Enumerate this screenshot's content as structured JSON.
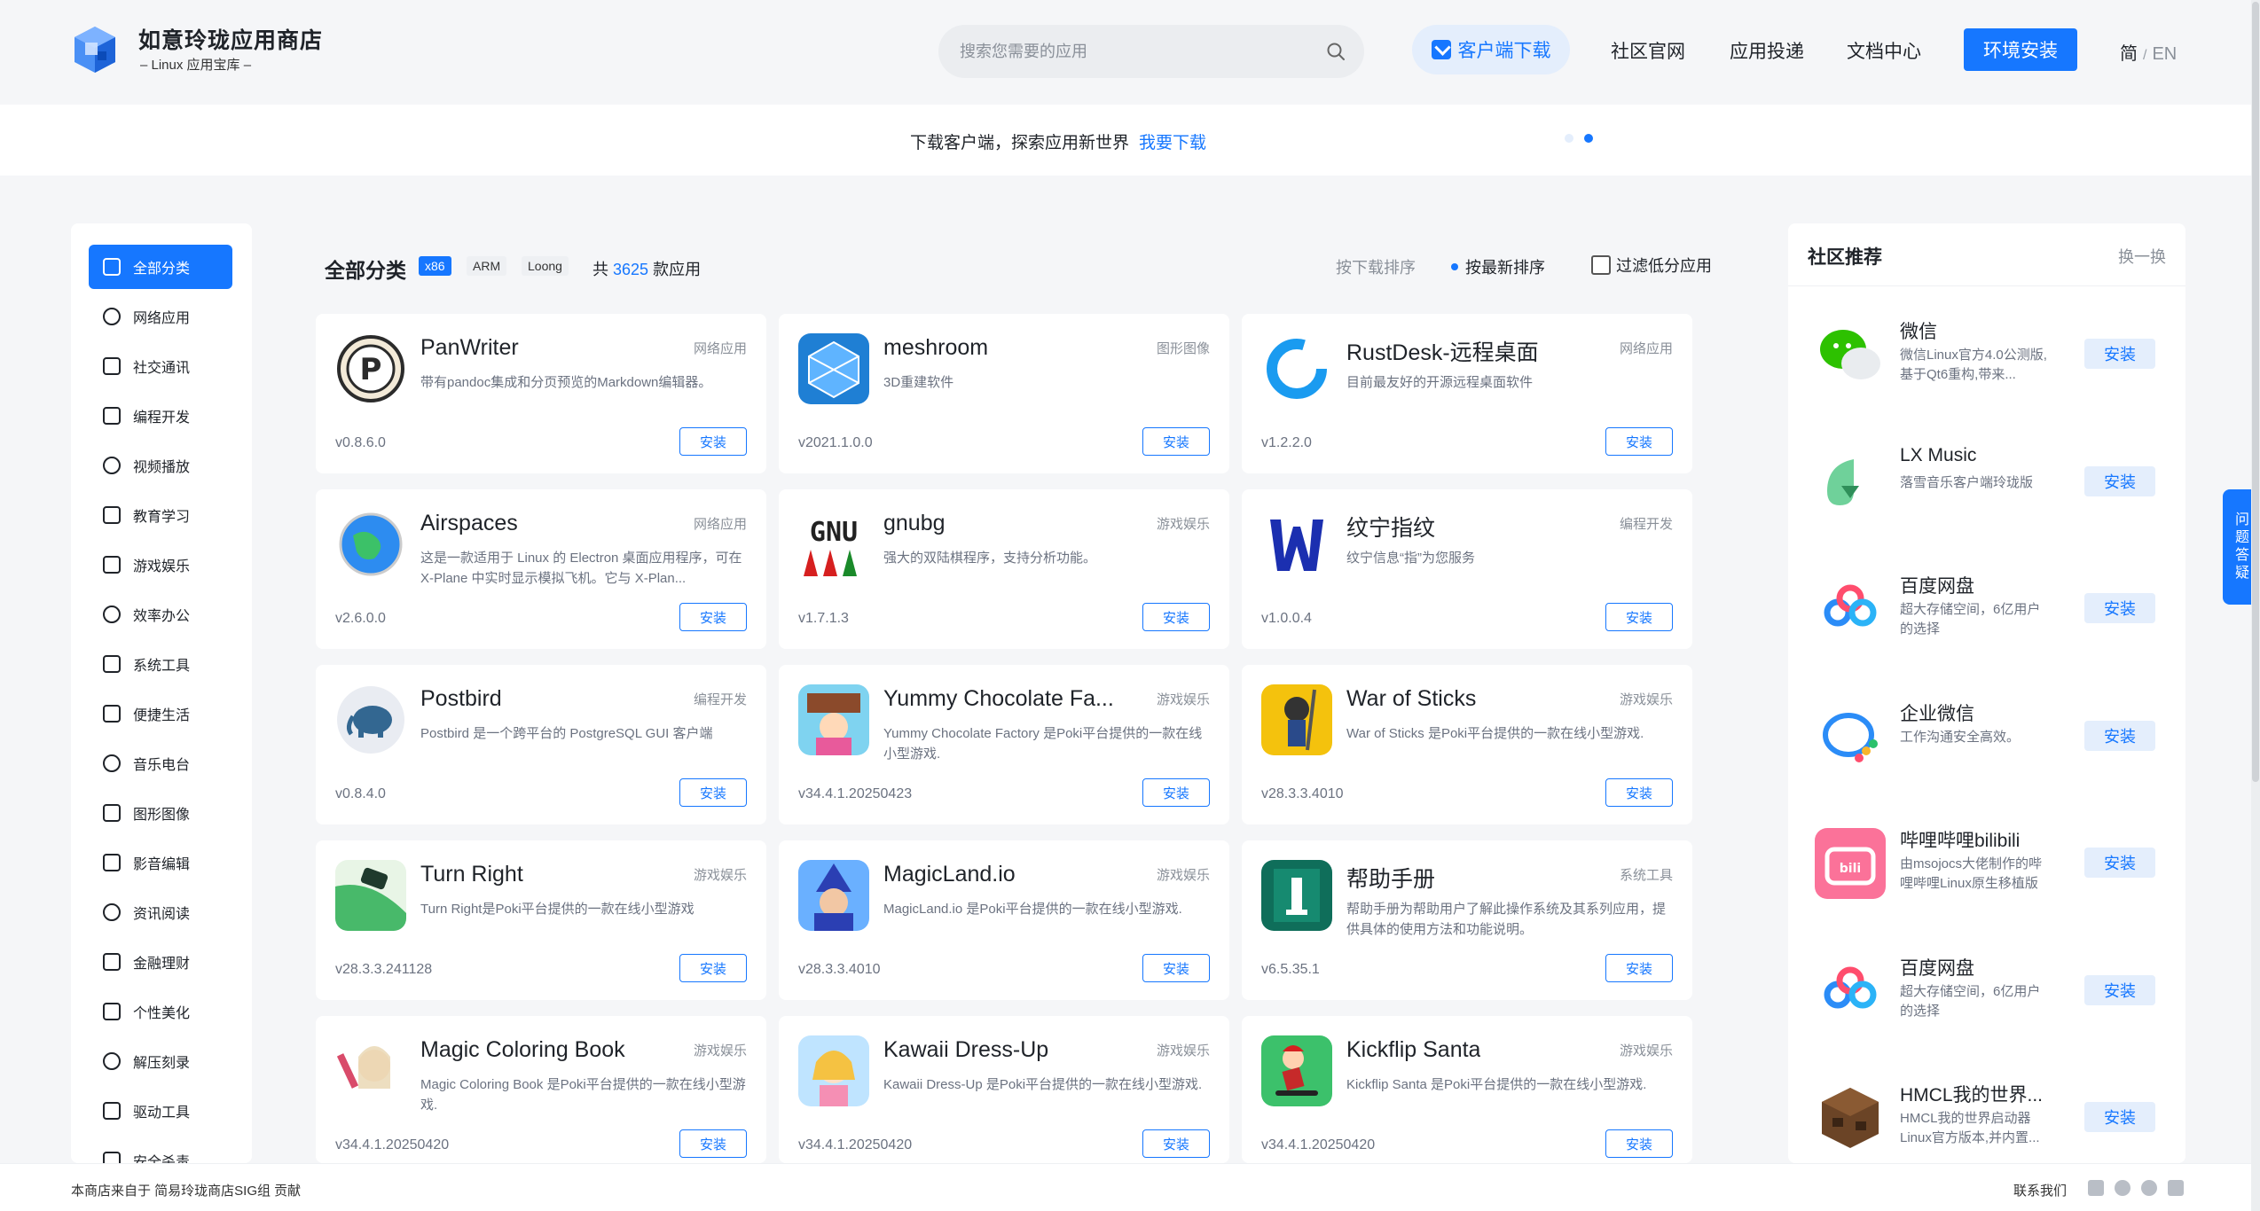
{
  "header": {
    "title": "如意玲珑应用商店",
    "subtitle": "– Linux 应用宝库 –",
    "search_placeholder": "搜索您需要的应用",
    "client_download": "客户端下载",
    "nav": [
      "社区官网",
      "应用投递",
      "文档中心"
    ],
    "env_install": "环境安装",
    "lang_zh": "简",
    "lang_sep": "/",
    "lang_en": "EN"
  },
  "banner": {
    "text": "下载客户端，探索应用新世界",
    "link": "我要下载"
  },
  "sidebar": {
    "items": [
      {
        "label": "全部分类",
        "icon": "grid-icon"
      },
      {
        "label": "网络应用",
        "icon": "cloud-icon"
      },
      {
        "label": "社交通讯",
        "icon": "phone-icon"
      },
      {
        "label": "编程开发",
        "icon": "pen-icon"
      },
      {
        "label": "视频播放",
        "icon": "video-icon"
      },
      {
        "label": "教育学习",
        "icon": "education-icon"
      },
      {
        "label": "游戏娱乐",
        "icon": "game-icon"
      },
      {
        "label": "效率办公",
        "icon": "document-icon"
      },
      {
        "label": "系统工具",
        "icon": "chip-icon"
      },
      {
        "label": "便捷生活",
        "icon": "life-icon"
      },
      {
        "label": "音乐电台",
        "icon": "headphones-icon"
      },
      {
        "label": "图形图像",
        "icon": "image-icon"
      },
      {
        "label": "影音编辑",
        "icon": "camera-icon"
      },
      {
        "label": "资讯阅读",
        "icon": "book-icon"
      },
      {
        "label": "金融理财",
        "icon": "card-icon"
      },
      {
        "label": "个性美化",
        "icon": "sparkle-icon"
      },
      {
        "label": "解压刻录",
        "icon": "disc-icon"
      },
      {
        "label": "驱动工具",
        "icon": "printer-icon"
      },
      {
        "label": "安全杀毒",
        "icon": "lock-icon"
      }
    ]
  },
  "main": {
    "title": "全部分类",
    "arch": [
      "x86",
      "ARM",
      "Loong"
    ],
    "count_prefix": "共",
    "count": "3625",
    "count_suffix": "款应用",
    "sort_download": "按下载排序",
    "sort_newest": "按最新排序",
    "filter_low": "过滤低分应用",
    "install_label": "安装",
    "apps": [
      {
        "name": "PanWriter",
        "category": "网络应用",
        "desc": "带有pandoc集成和分页预览的Markdown编辑器。",
        "version": "v0.8.6.0"
      },
      {
        "name": "meshroom",
        "category": "图形图像",
        "desc": "3D重建软件",
        "version": "v2021.1.0.0"
      },
      {
        "name": "RustDesk-远程桌面",
        "category": "网络应用",
        "desc": "目前最友好的开源远程桌面软件",
        "version": "v1.2.2.0"
      },
      {
        "name": "Airspaces",
        "category": "网络应用",
        "desc": "这是一款适用于 Linux 的 Electron 桌面应用程序，可在 X-Plane 中实时显示模拟飞机。它与 X-Plan...",
        "version": "v2.6.0.0"
      },
      {
        "name": "gnubg",
        "category": "游戏娱乐",
        "desc": "强大的双陆棋程序，支持分析功能。",
        "version": "v1.7.1.3"
      },
      {
        "name": "纹宁指纹",
        "category": "编程开发",
        "desc": "纹宁信息“指”为您服务",
        "version": "v1.0.0.4"
      },
      {
        "name": "Postbird",
        "category": "编程开发",
        "desc": "Postbird 是一个跨平台的 PostgreSQL GUI 客户端",
        "version": "v0.8.4.0"
      },
      {
        "name": "Yummy Chocolate Fa...",
        "category": "游戏娱乐",
        "desc": "Yummy Chocolate Factory 是Poki平台提供的一款在线小型游戏.",
        "version": "v34.4.1.20250423"
      },
      {
        "name": "War of Sticks",
        "category": "游戏娱乐",
        "desc": "War of Sticks 是Poki平台提供的一款在线小型游戏.",
        "version": "v28.3.3.4010"
      },
      {
        "name": "Turn Right",
        "category": "游戏娱乐",
        "desc": "Turn Right是Poki平台提供的一款在线小型游戏",
        "version": "v28.3.3.241128"
      },
      {
        "name": "MagicLand.io",
        "category": "游戏娱乐",
        "desc": "MagicLand.io 是Poki平台提供的一款在线小型游戏.",
        "version": "v28.3.3.4010"
      },
      {
        "name": "帮助手册",
        "category": "系统工具",
        "desc": "帮助手册为帮助用户了解此操作系统及其系列应用，提供具体的使用方法和功能说明。",
        "version": "v6.5.35.1"
      },
      {
        "name": "Magic Coloring Book",
        "category": "游戏娱乐",
        "desc": "Magic Coloring Book 是Poki平台提供的一款在线小型游戏.",
        "version": "v34.4.1.20250420"
      },
      {
        "name": "Kawaii Dress-Up",
        "category": "游戏娱乐",
        "desc": "Kawaii Dress-Up 是Poki平台提供的一款在线小型游戏.",
        "version": "v34.4.1.20250420"
      },
      {
        "name": "Kickflip Santa",
        "category": "游戏娱乐",
        "desc": "Kickflip Santa 是Poki平台提供的一款在线小型游戏.",
        "version": "v34.4.1.20250420"
      }
    ]
  },
  "recommend": {
    "title": "社区推荐",
    "refresh": "换一换",
    "install_label": "安装",
    "items": [
      {
        "name": "微信",
        "desc": "微信Linux官方4.0公测版,基于Qt6重构,带来..."
      },
      {
        "name": "LX Music",
        "desc": "落雪音乐客户端玲珑版"
      },
      {
        "name": "百度网盘",
        "desc": "超大存储空间，6亿用户的选择"
      },
      {
        "name": "企业微信",
        "desc": "工作沟通安全高效。"
      },
      {
        "name": "哔哩哔哩bilibili",
        "desc": "由msojocs大佬制作的哔哩哔哩Linux原生移植版"
      },
      {
        "name": "百度网盘",
        "desc": "超大存储空间，6亿用户的选择"
      },
      {
        "name": "HMCL我的世界...",
        "desc": "HMCL我的世界启动器Linux官方版本,并内置..."
      }
    ]
  },
  "float_tab": "问题答疑",
  "footer": {
    "text": "本商店来自于 简易玲珑商店SIG组 贡献",
    "contact": "联系我们"
  },
  "colors": {
    "accent": "#1677ff",
    "background": "#f5f6f8"
  }
}
